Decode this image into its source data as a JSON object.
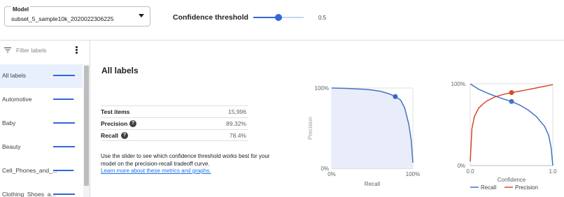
{
  "model": {
    "label": "Model",
    "value": "subset_5_sample10k_2020022306225"
  },
  "confidence": {
    "label": "Confidence threshold",
    "value": 0.5,
    "value_text": "0.5"
  },
  "sidebar": {
    "filter_placeholder": "Filter labels",
    "items": [
      {
        "label": "All labels",
        "fill": 1.0,
        "active": true
      },
      {
        "label": "Automotive",
        "fill": 0.95,
        "active": false
      },
      {
        "label": "Baby",
        "fill": 1.0,
        "active": false
      },
      {
        "label": "Beauty",
        "fill": 1.0,
        "active": false
      },
      {
        "label": "Cell_Phones_and_...",
        "fill": 0.95,
        "active": false
      },
      {
        "label": "Clothing_Shoes_a...",
        "fill": 1.0,
        "active": false
      }
    ]
  },
  "main": {
    "title": "All labels",
    "metrics": [
      {
        "name": "Test items",
        "value": "15,996",
        "help": false
      },
      {
        "name": "Precision",
        "value": "89.32%",
        "help": true
      },
      {
        "name": "Recall",
        "value": "78.4%",
        "help": true
      }
    ],
    "description": "Use the slider to see which confidence threshold works best for your model on the precision-recall tradeoff curve.",
    "link_text": "Learn more about these metrics and graphs."
  },
  "colors": {
    "accent": "#3367d6",
    "recall_line": "#4472c4",
    "precision_line": "#d84a2a",
    "pr_area": "#e8edf9"
  },
  "chart_data": [
    {
      "type": "area",
      "title": "",
      "xlabel": "Recall",
      "ylabel": "Precision",
      "xlim": [
        0,
        1
      ],
      "ylim": [
        0,
        1
      ],
      "x_ticks": [
        "0%",
        "100%"
      ],
      "y_ticks": [
        "0%",
        "100%"
      ],
      "series": [
        {
          "x": [
            0,
            0.1,
            0.2,
            0.3,
            0.4,
            0.5,
            0.6,
            0.7,
            0.75,
            0.784,
            0.85,
            0.9,
            0.95,
            0.98,
            1.0
          ],
          "y": [
            1.0,
            0.997,
            0.995,
            0.99,
            0.985,
            0.975,
            0.96,
            0.93,
            0.91,
            0.893,
            0.85,
            0.75,
            0.55,
            0.35,
            0.07
          ]
        }
      ],
      "marker": {
        "x": 0.784,
        "y": 0.893
      }
    },
    {
      "type": "line",
      "title": "",
      "xlabel": "Confidence",
      "ylabel": "",
      "xlim": [
        0,
        1
      ],
      "ylim": [
        0,
        1
      ],
      "x_ticks": [
        "0.0",
        "1.0"
      ],
      "y_ticks": [
        "0%",
        "100%"
      ],
      "legend": "bottom",
      "series": [
        {
          "name": "Recall",
          "x": [
            0,
            0.1,
            0.2,
            0.3,
            0.4,
            0.5,
            0.6,
            0.7,
            0.8,
            0.9,
            0.95,
            0.98,
            1.0
          ],
          "y": [
            1.0,
            0.935,
            0.89,
            0.85,
            0.815,
            0.784,
            0.74,
            0.68,
            0.6,
            0.48,
            0.37,
            0.22,
            0.0
          ]
        },
        {
          "name": "Precision",
          "x": [
            0,
            0.02,
            0.05,
            0.1,
            0.15,
            0.2,
            0.3,
            0.4,
            0.5,
            0.6,
            0.7,
            0.8,
            0.9,
            1.0
          ],
          "y": [
            0.05,
            0.45,
            0.6,
            0.7,
            0.75,
            0.79,
            0.84,
            0.87,
            0.893,
            0.91,
            0.93,
            0.95,
            0.97,
            0.99
          ]
        }
      ],
      "markers": [
        {
          "series": "Recall",
          "x": 0.5,
          "y": 0.784
        },
        {
          "series": "Precision",
          "x": 0.5,
          "y": 0.893
        }
      ]
    }
  ]
}
